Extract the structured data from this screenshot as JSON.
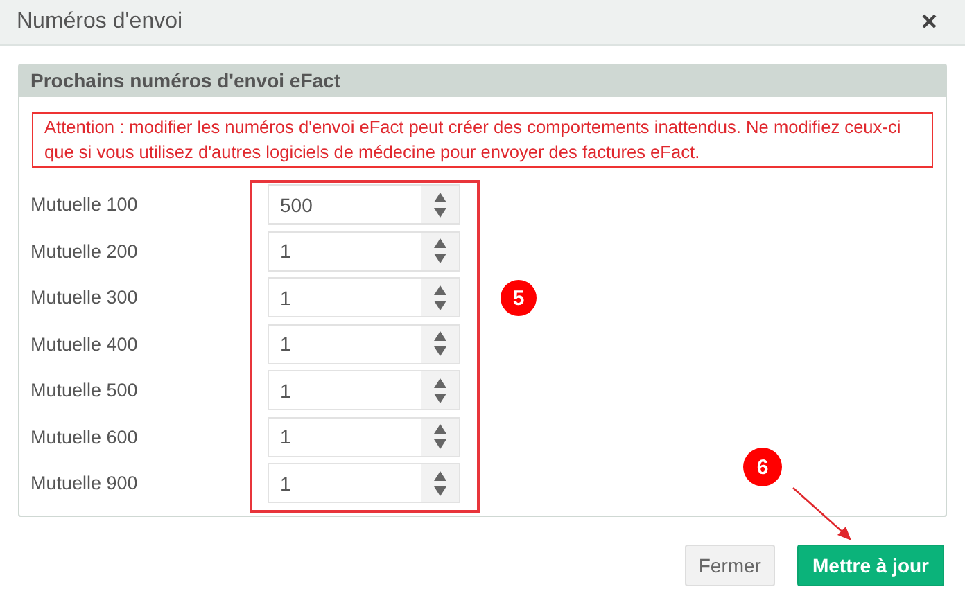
{
  "window": {
    "title": "Numéros d'envoi",
    "close": "×"
  },
  "panel": {
    "title": "Prochains numéros d'envoi eFact",
    "warning": "Attention : modifier les numéros d'envoi eFact peut créer des comportements inattendus. Ne modifiez ceux-ci que si vous utilisez d'autres logiciels de médecine pour envoyer des factures eFact.",
    "rows": [
      {
        "label": "Mutuelle 100",
        "value": "500"
      },
      {
        "label": "Mutuelle 200",
        "value": "1"
      },
      {
        "label": "Mutuelle 300",
        "value": "1"
      },
      {
        "label": "Mutuelle 400",
        "value": "1"
      },
      {
        "label": "Mutuelle 500",
        "value": "1"
      },
      {
        "label": "Mutuelle 600",
        "value": "1"
      },
      {
        "label": "Mutuelle 900",
        "value": "1"
      }
    ]
  },
  "annotations": [
    {
      "text": "5"
    },
    {
      "text": "6"
    }
  ],
  "buttons": [
    {
      "label": "Fermer",
      "kind": "secondary"
    },
    {
      "label": "Mettre à jour",
      "kind": "primary"
    }
  ]
}
